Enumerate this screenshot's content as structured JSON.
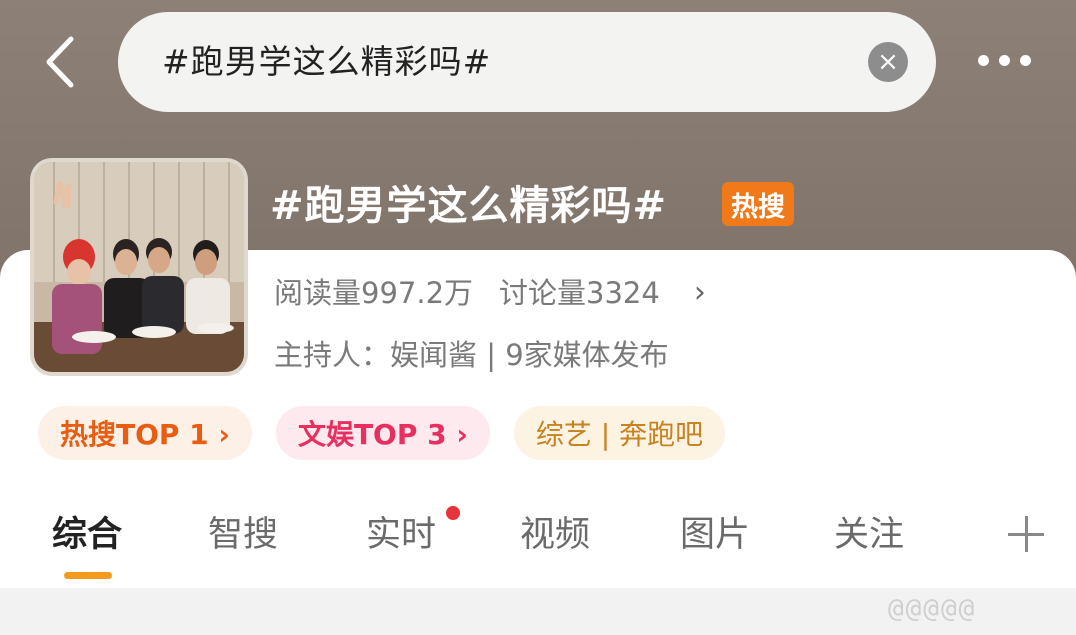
{
  "search": {
    "query": "#跑男学这么精彩吗#"
  },
  "topic": {
    "title": "#跑男学这么精彩吗#",
    "hot_badge": "热搜",
    "reads_label": "阅读量997.2万",
    "discussions_label": "讨论量3324",
    "host_label": "主持人：娱闻酱 | 9家媒体发布"
  },
  "tags": [
    {
      "label": "热搜TOP 1 ›"
    },
    {
      "label": "文娱TOP 3 ›"
    },
    {
      "label": "综艺 | 奔跑吧"
    }
  ],
  "tabs": [
    {
      "label": "综合",
      "active": true
    },
    {
      "label": "智搜"
    },
    {
      "label": "实时"
    },
    {
      "label": "视频"
    },
    {
      "label": "图片"
    },
    {
      "label": "关注"
    }
  ],
  "watermark": "@@@@@",
  "colors": {
    "header_bg": "#8d8177",
    "hot_badge": "#f07a1a",
    "tab_indicator": "#f39b1e",
    "live_dot": "#e8323c"
  },
  "icons": [
    "back-chevron-icon",
    "clear-icon",
    "more-icon",
    "chevron-right-icon",
    "add-icon"
  ]
}
